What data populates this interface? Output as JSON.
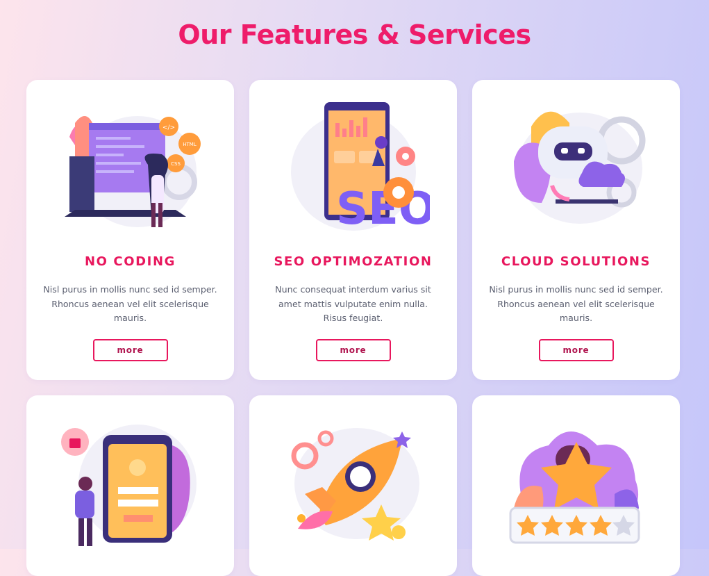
{
  "page": {
    "title": "Our Features & Services"
  },
  "colors": {
    "accent": "#ee1c6a",
    "button_border": "#e8175d",
    "body_text": "#5b5f70"
  },
  "cards": [
    {
      "title": "NO CODING",
      "text": "Nisl purus in mollis nunc sed id semper. Rhoncus aenean vel elit scelerisque mauris.",
      "button": "more",
      "icon": "no-coding-illustration"
    },
    {
      "title": "SEO OPTIMOZATION",
      "text": "Nunc consequat interdum varius sit amet mattis vulputate enim nulla. Risus feugiat.",
      "button": "more",
      "icon": "seo-illustration"
    },
    {
      "title": "CLOUD SOLUTIONS",
      "text": "Nisl purus in mollis nunc sed id semper. Rhoncus aenean vel elit scelerisque mauris.",
      "button": "more",
      "icon": "cloud-robot-illustration"
    },
    {
      "icon": "security-login-illustration"
    },
    {
      "icon": "rocket-launch-illustration"
    },
    {
      "icon": "rating-stars-illustration"
    }
  ],
  "illustration_labels": {
    "code_tag": "</>",
    "html_tag": "HTML",
    "css_tag": "CSS",
    "seo_text": "SEO"
  }
}
